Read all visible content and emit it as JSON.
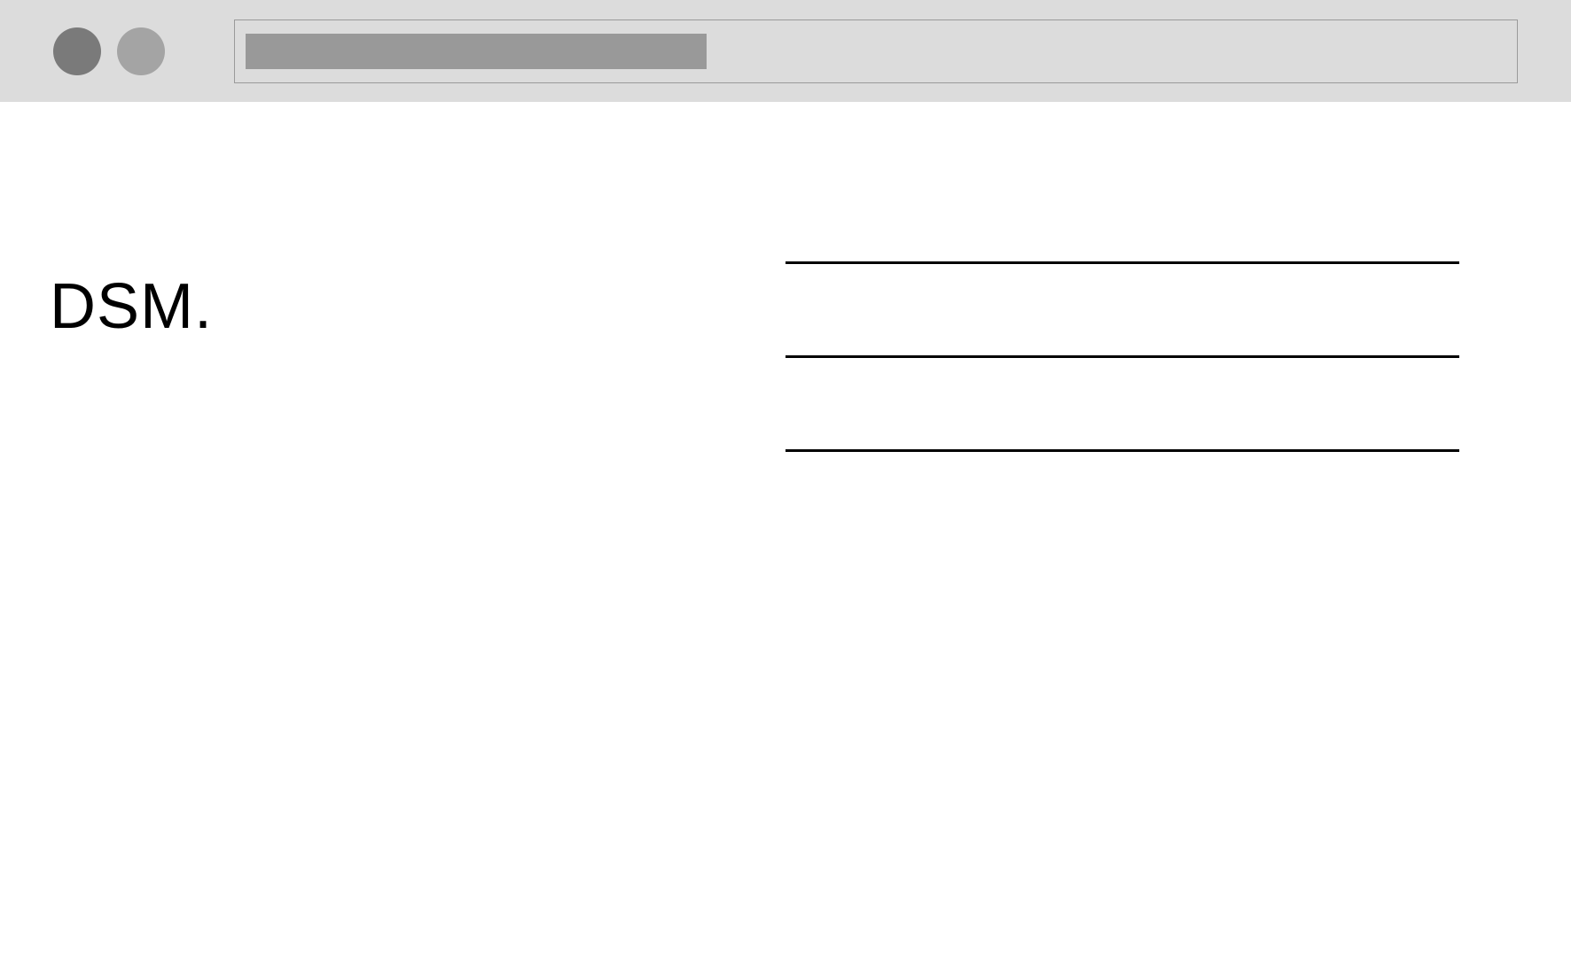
{
  "browser": {
    "window_controls": {
      "control_1_color": "#7a7a7a",
      "control_2_color": "#a4a4a4"
    },
    "address_bar": {
      "placeholder": ""
    }
  },
  "page": {
    "logo_text": "DSM.",
    "menu_items": [
      {
        "label": ""
      },
      {
        "label": ""
      },
      {
        "label": ""
      }
    ]
  }
}
